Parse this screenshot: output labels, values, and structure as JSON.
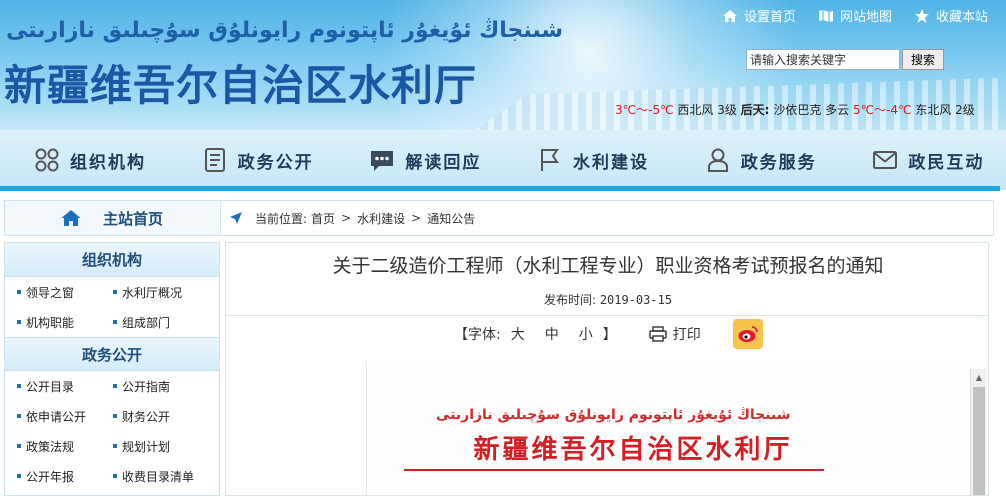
{
  "header": {
    "uyghur_title": "شىنجاڭ ئۇيغۇر ئاپتونوم رايونلۇق سۇچىلىق نازارىتى",
    "title": "新疆维吾尔自治区水利厅",
    "top_links": [
      "设置首页",
      "网站地图",
      "收藏本站"
    ],
    "search_placeholder": "请输入搜索关键字",
    "search_button": "搜索",
    "weather": {
      "temp1": "3℃～-5℃",
      "wind1": "西北风 3级",
      "city_label": "后天:",
      "city_text": "沙依巴克 多云",
      "temp2": "5℃～-4℃",
      "wind2": "东北风 2级"
    }
  },
  "nav": [
    "组织机构",
    "政务公开",
    "解读回应",
    "水利建设",
    "政务服务",
    "政民互动"
  ],
  "breadcrumb": {
    "home": "主站首页",
    "label": "当前位置:",
    "items": [
      "首页",
      "水利建设",
      "通知公告"
    ]
  },
  "sidebar": {
    "sections": [
      {
        "title": "组织机构",
        "links": [
          "领导之窗",
          "水利厅概况",
          "机构职能",
          "组成部门"
        ]
      },
      {
        "title": "政务公开",
        "links": [
          "公开目录",
          "公开指南",
          "依申请公开",
          "财务公开",
          "政策法规",
          "规划计划",
          "公开年报",
          "收费目录清单"
        ]
      }
    ]
  },
  "article": {
    "title": "关于二级造价工程师（水利工程专业）职业资格考试预报名的通知",
    "date_label": "发布时间:",
    "date": "2019-03-15",
    "font_label": "【字体:",
    "sizes": [
      "大",
      "中",
      "小"
    ],
    "font_end": "】",
    "print": "打印",
    "doc_uyghur": "شىنجاڭ ئۇيغۇر ئاپتونوم رايونلۇق سۇچىلىق نازارىتى",
    "doc_title": "新疆维吾尔自治区水利厅"
  },
  "colors": {
    "nav_line": "#1ea4e0",
    "doc_red": "#d31f24",
    "title_blue": "#1b57a3"
  }
}
